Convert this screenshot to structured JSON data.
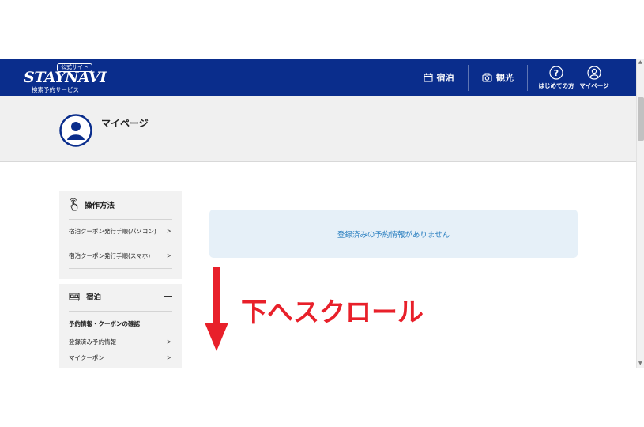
{
  "header": {
    "logo_badge": "公式サイト",
    "logo_main": "STAYNAVI",
    "logo_sub": "検索予約サービス",
    "nav": {
      "stay": "宿泊",
      "sightseeing": "観光",
      "first_time": "はじめての方",
      "mypage": "マイページ"
    },
    "brand_color": "#0a2d8c"
  },
  "profile": {
    "title": "マイページ"
  },
  "sidebar": {
    "howto": {
      "title": "操作方法",
      "links": [
        "宿泊クーポン発行手順(パソコン)",
        "宿泊クーポン発行手順(スマホ)"
      ]
    },
    "stay": {
      "title": "宿泊",
      "section_label": "予約情報・クーポンの確認",
      "links": [
        "登録済み予約情報",
        "マイクーポン"
      ]
    }
  },
  "main": {
    "empty_message": "登録済みの予約情報がありません"
  },
  "annotation": {
    "text": "下へスクロール",
    "color": "#e8202a"
  }
}
